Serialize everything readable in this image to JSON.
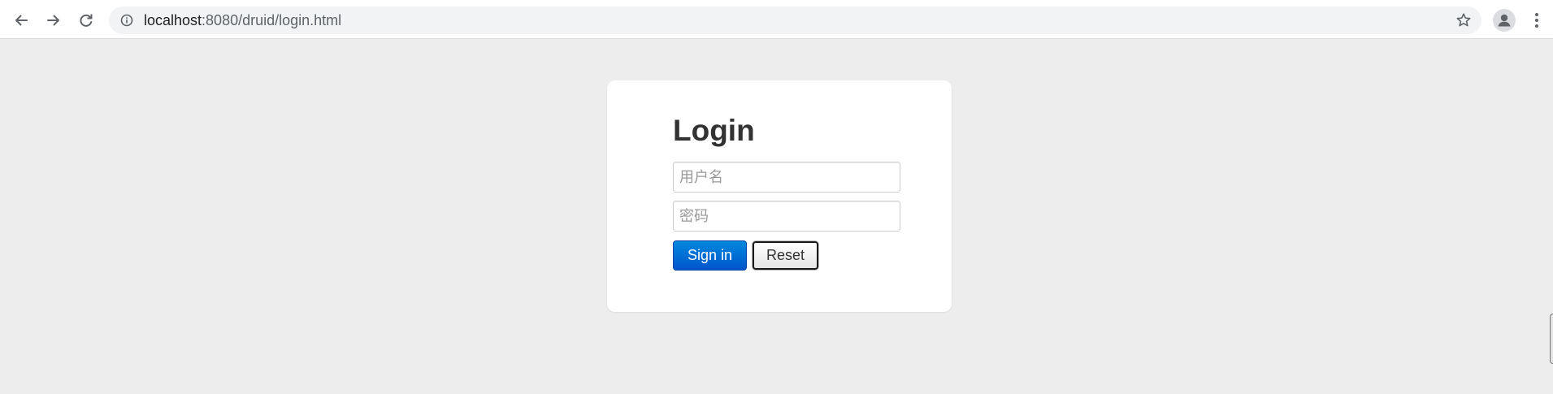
{
  "browser": {
    "back_icon": "arrow-left-icon",
    "forward_icon": "arrow-right-icon",
    "reload_icon": "reload-icon",
    "site_info_icon": "info-icon",
    "url_host": "localhost",
    "url_path": ":8080/druid/login.html",
    "bookmark_icon": "star-icon",
    "profile_icon": "person-icon",
    "menu_icon": "more-vertical-icon"
  },
  "login": {
    "title": "Login",
    "username_placeholder": "用户名",
    "username_value": "",
    "password_placeholder": "密码",
    "password_value": "",
    "signin_label": "Sign in",
    "reset_label": "Reset"
  },
  "colors": {
    "page_background": "#ededed",
    "card_background": "#ffffff",
    "primary_button": "#0066cc",
    "title_text": "#333333"
  }
}
